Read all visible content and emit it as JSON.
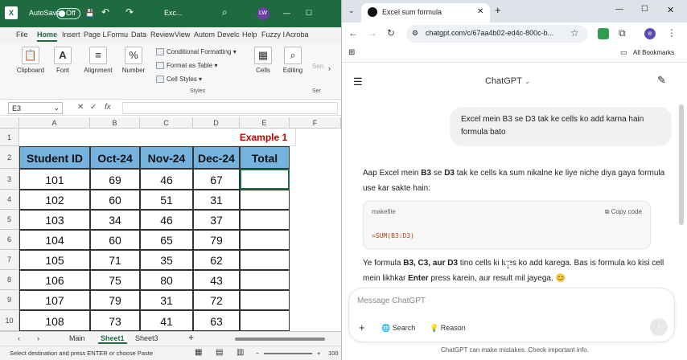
{
  "excel": {
    "autosave_label": "AutoSave",
    "toggle_label": "Off",
    "filename": "Exc...",
    "user_initials": "LW",
    "menu": [
      "File",
      "Home",
      "Insert",
      "Page L",
      "Formu",
      "Data",
      "Review",
      "View",
      "Autom",
      "Develc",
      "Help",
      "Fuzzy I",
      "Acroba"
    ],
    "ribbon": {
      "clipboard": "Clipboard",
      "font": "Font",
      "alignment": "Alignment",
      "number": "Number",
      "conditional": "Conditional Formatting",
      "format_table": "Format as Table",
      "cell_styles": "Cell Styles",
      "styles_group": "Styles",
      "cells": "Cells",
      "editing": "Editing",
      "sen": "Sen",
      "ser": "Ser"
    },
    "name_box": "E3",
    "fx": "fx",
    "columns": [
      "A",
      "B",
      "C",
      "D",
      "E",
      "F"
    ],
    "rows": [
      "1",
      "2",
      "3",
      "4",
      "5",
      "6",
      "7",
      "8",
      "9",
      "10"
    ],
    "example_label": "Example 1",
    "table_headers": [
      "Student ID",
      "Oct-24",
      "Nov-24",
      "Dec-24",
      "Total"
    ],
    "table_rows": [
      [
        "101",
        "69",
        "46",
        "67",
        ""
      ],
      [
        "102",
        "60",
        "51",
        "31",
        ""
      ],
      [
        "103",
        "34",
        "46",
        "37",
        ""
      ],
      [
        "104",
        "60",
        "65",
        "79",
        ""
      ],
      [
        "105",
        "71",
        "35",
        "62",
        ""
      ],
      [
        "106",
        "75",
        "80",
        "43",
        ""
      ],
      [
        "107",
        "79",
        "31",
        "72",
        ""
      ],
      [
        "108",
        "73",
        "41",
        "63",
        ""
      ]
    ],
    "sheets": [
      "Main",
      "Sheet1",
      "Sheet3"
    ],
    "add_sheet": "+",
    "status_text": "Select destination and press ENTER or choose Paste",
    "zoom": "100"
  },
  "chrome": {
    "tab_title": "Excel sum formula",
    "url": "chatgpt.com/c/67aa4b02-ed4c-800c-b...",
    "bookmarks_label": "All Bookmarks",
    "app_title": "ChatGPT",
    "user_message": "Excel mein B3 se D3 tak ke cells ko add karna hain formula bato",
    "reply_intro": [
      {
        "t": "Aap Excel mein ",
        "b": false
      },
      {
        "t": "B3",
        "b": true
      },
      {
        "t": " se ",
        "b": false
      },
      {
        "t": "D3",
        "b": true
      },
      {
        "t": " tak ke cells ka sum nikalne ke liye niche diya gaya formula use kar sakte hain:",
        "b": false
      }
    ],
    "code_lang": "makefile",
    "copy_label": "Copy code",
    "code": "=SUM(B3:D3)",
    "reply_outro": [
      {
        "t": "Ye formula ",
        "b": false
      },
      {
        "t": "B3, C3, aur D3",
        "b": true
      },
      {
        "t": " tino cells ki ",
        "b": false
      },
      {
        "t": "lues ko add karega. Bas is formula ko kisi cell mein likhkar ",
        "b": false
      },
      {
        "t": "Enter",
        "b": true
      },
      {
        "t": " press karein, aur result mil jayega. 😊",
        "b": false
      }
    ],
    "composer_placeholder": "Message ChatGPT",
    "search_label": "Search",
    "reason_label": "Reason",
    "footer": "ChatGPT can make mistakes. Check important info.",
    "profile_initial": "e"
  },
  "colors": {
    "excel_green": "#1d6b3f",
    "header_blue": "#75b2dd",
    "example_red": "#c00000"
  }
}
